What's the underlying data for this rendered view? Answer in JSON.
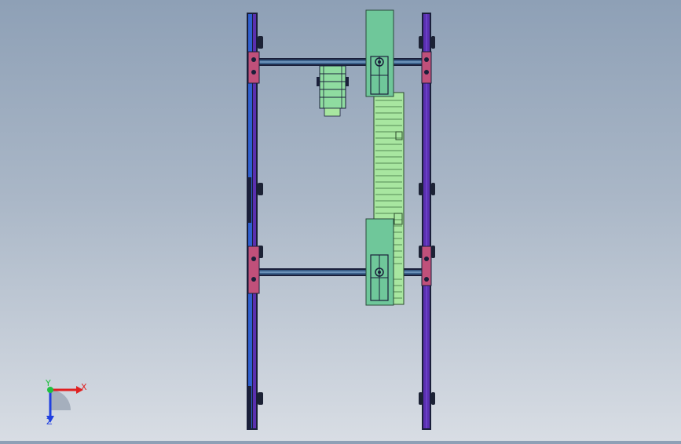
{
  "viewport": {
    "background_top": "#8ea0b6",
    "background_bottom": "#d8dde4"
  },
  "colors": {
    "rail_blue": "#2f5fd0",
    "rail_purple": "#5a2fb0",
    "rail_dark": "#1a1f3a",
    "beam": "#3a5f8a",
    "carriage_green": "#6fc79a",
    "conveyor_green": "#a8e6a0",
    "bracket_pink": "#c0507a",
    "wheel_dark": "#1c2235"
  },
  "triad": {
    "x_label": "X",
    "y_label": "Y",
    "z_label": "Z",
    "x_color": "#e02020",
    "y_color": "#20c040",
    "z_color": "#2040e0"
  }
}
